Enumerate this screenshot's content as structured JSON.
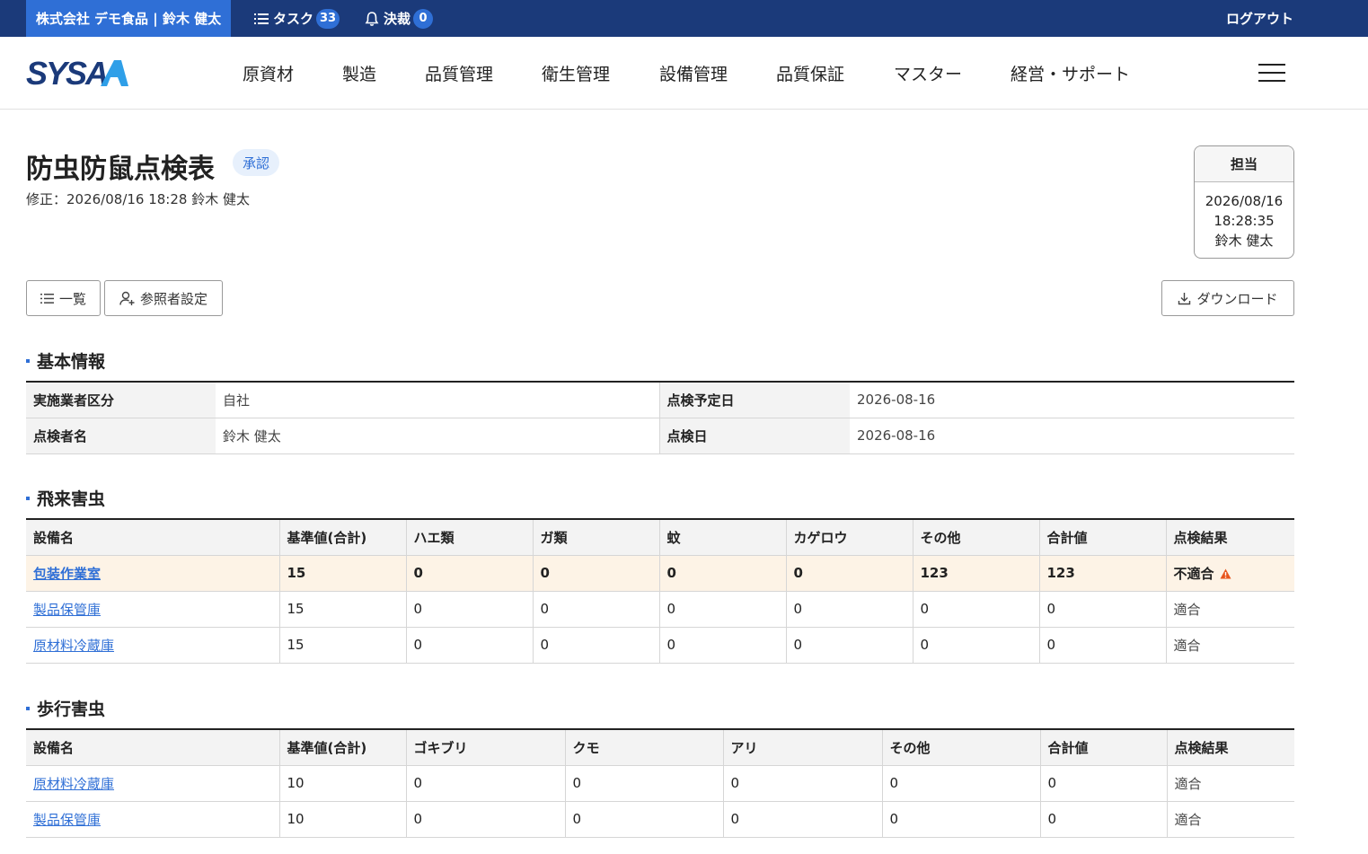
{
  "topbar": {
    "company": "株式会社 デモ食品 | 鈴木 健太",
    "tasks_label": "タスク",
    "tasks_count": "33",
    "approvals_label": "決裁",
    "approvals_count": "0",
    "logout": "ログアウト"
  },
  "nav": {
    "logo": "SYSA",
    "items": [
      "原資材",
      "製造",
      "品質管理",
      "衛生管理",
      "設備管理",
      "品質保証",
      "マスター",
      "経営・サポート"
    ]
  },
  "page": {
    "title": "防虫防鼠点検表",
    "status": "承認",
    "modified": "修正：2026/08/16 18:28  鈴木 健太"
  },
  "stamp": {
    "role": "担当",
    "date": "2026/08/16",
    "time": "18:28:35",
    "name": "鈴木 健太"
  },
  "buttons": {
    "list": "一覧",
    "viewers": "参照者設定",
    "download": "ダウンロード"
  },
  "basic_info": {
    "title": "基本情報",
    "rows": [
      {
        "label1": "実施業者区分",
        "value1": "自社",
        "label2": "点検予定日",
        "value2": "2026-08-16"
      },
      {
        "label1": "点検者名",
        "value1": "鈴木 健太",
        "label2": "点検日",
        "value2": "2026-08-16"
      }
    ]
  },
  "flying": {
    "title": "飛来害虫",
    "headers": [
      "設備名",
      "基準値(合計)",
      "ハエ類",
      "ガ類",
      "蚊",
      "カゲロウ",
      "その他",
      "合計値",
      "点検結果"
    ],
    "rows": [
      {
        "name": "包装作業室",
        "cells": [
          "15",
          "0",
          "0",
          "0",
          "0",
          "123",
          "123"
        ],
        "result": "不適合",
        "alert": true
      },
      {
        "name": "製品保管庫",
        "cells": [
          "15",
          "0",
          "0",
          "0",
          "0",
          "0",
          "0"
        ],
        "result": "適合",
        "alert": false
      },
      {
        "name": "原材料冷蔵庫",
        "cells": [
          "15",
          "0",
          "0",
          "0",
          "0",
          "0",
          "0"
        ],
        "result": "適合",
        "alert": false
      }
    ]
  },
  "crawling": {
    "title": "歩行害虫",
    "headers": [
      "設備名",
      "基準値(合計)",
      "ゴキブリ",
      "クモ",
      "アリ",
      "その他",
      "合計値",
      "点検結果"
    ],
    "rows": [
      {
        "name": "原材料冷蔵庫",
        "cells": [
          "10",
          "0",
          "0",
          "0",
          "0",
          "0"
        ],
        "result": "適合"
      },
      {
        "name": "製品保管庫",
        "cells": [
          "10",
          "0",
          "0",
          "0",
          "0",
          "0"
        ],
        "result": "適合"
      }
    ]
  },
  "colors": {
    "brand": "#2f6fd6",
    "topbar": "#1b3a7a",
    "alert_row": "#fdf3e6",
    "warning": "#e8541c"
  }
}
